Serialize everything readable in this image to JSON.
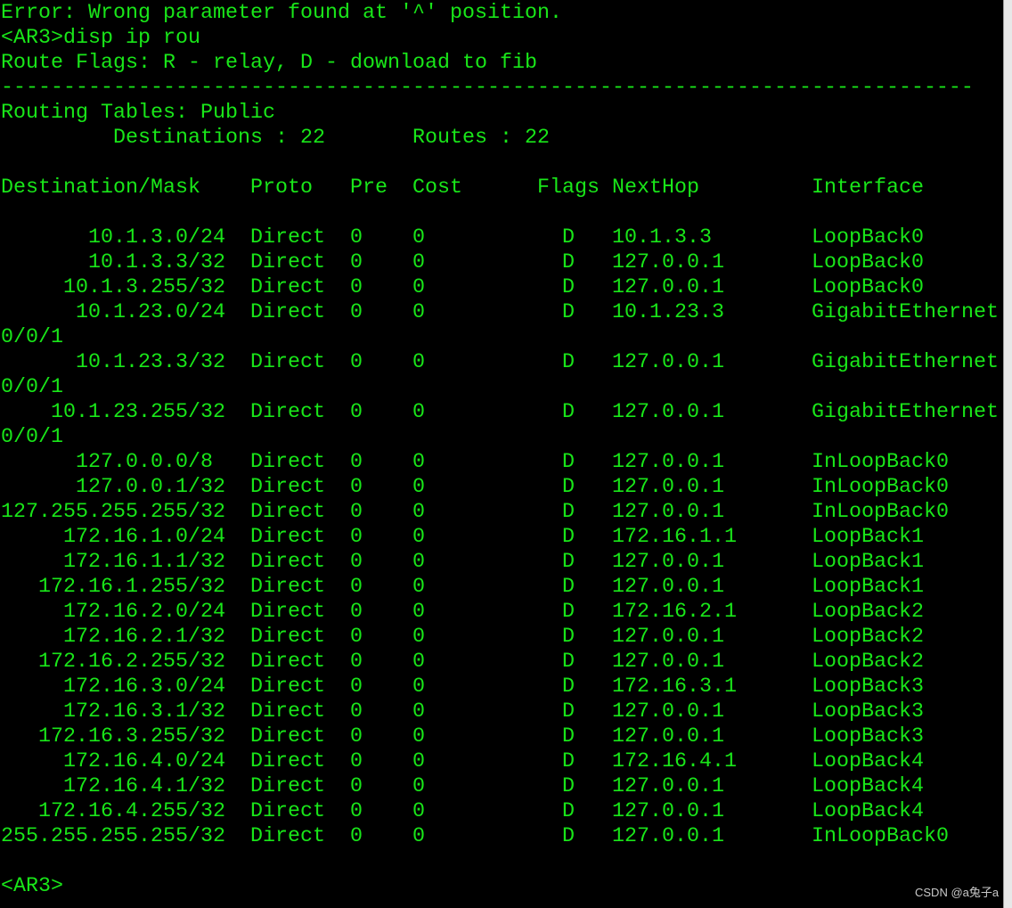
{
  "colors": {
    "background": "#000000",
    "text": "#19e619",
    "watermark": "#c8c8c8"
  },
  "error_message": "Error: Wrong parameter found at '^' position.",
  "prompt": "<AR3>",
  "command": "disp ip rou",
  "route_flags": "Route Flags: R - relay, D - download to fib",
  "separator": "------------------------------------------------------------------------------",
  "routing_tables": "Routing Tables: Public",
  "summary": {
    "destinations": "Destinations : 22",
    "routes": "Routes : 22"
  },
  "columns": [
    "Destination/Mask",
    "Proto",
    "Pre",
    "Cost",
    "Flags",
    "NextHop",
    "Interface"
  ],
  "routes": [
    {
      "destination": "10.1.3.0/24",
      "proto": "Direct",
      "pre": "0",
      "cost": "0",
      "flags": "D",
      "nexthop": "10.1.3.3",
      "interface": "LoopBack0"
    },
    {
      "destination": "10.1.3.3/32",
      "proto": "Direct",
      "pre": "0",
      "cost": "0",
      "flags": "D",
      "nexthop": "127.0.0.1",
      "interface": "LoopBack0"
    },
    {
      "destination": "10.1.3.255/32",
      "proto": "Direct",
      "pre": "0",
      "cost": "0",
      "flags": "D",
      "nexthop": "127.0.0.1",
      "interface": "LoopBack0"
    },
    {
      "destination": "10.1.23.0/24",
      "proto": "Direct",
      "pre": "0",
      "cost": "0",
      "flags": "D",
      "nexthop": "10.1.23.3",
      "interface": "GigabitEthernet0/0/1"
    },
    {
      "destination": "10.1.23.3/32",
      "proto": "Direct",
      "pre": "0",
      "cost": "0",
      "flags": "D",
      "nexthop": "127.0.0.1",
      "interface": "GigabitEthernet0/0/1"
    },
    {
      "destination": "10.1.23.255/32",
      "proto": "Direct",
      "pre": "0",
      "cost": "0",
      "flags": "D",
      "nexthop": "127.0.0.1",
      "interface": "GigabitEthernet0/0/1"
    },
    {
      "destination": "127.0.0.0/8",
      "proto": "Direct",
      "pre": "0",
      "cost": "0",
      "flags": "D",
      "nexthop": "127.0.0.1",
      "interface": "InLoopBack0"
    },
    {
      "destination": "127.0.0.1/32",
      "proto": "Direct",
      "pre": "0",
      "cost": "0",
      "flags": "D",
      "nexthop": "127.0.0.1",
      "interface": "InLoopBack0"
    },
    {
      "destination": "127.255.255.255/32",
      "proto": "Direct",
      "pre": "0",
      "cost": "0",
      "flags": "D",
      "nexthop": "127.0.0.1",
      "interface": "InLoopBack0"
    },
    {
      "destination": "172.16.1.0/24",
      "proto": "Direct",
      "pre": "0",
      "cost": "0",
      "flags": "D",
      "nexthop": "172.16.1.1",
      "interface": "LoopBack1"
    },
    {
      "destination": "172.16.1.1/32",
      "proto": "Direct",
      "pre": "0",
      "cost": "0",
      "flags": "D",
      "nexthop": "127.0.0.1",
      "interface": "LoopBack1"
    },
    {
      "destination": "172.16.1.255/32",
      "proto": "Direct",
      "pre": "0",
      "cost": "0",
      "flags": "D",
      "nexthop": "127.0.0.1",
      "interface": "LoopBack1"
    },
    {
      "destination": "172.16.2.0/24",
      "proto": "Direct",
      "pre": "0",
      "cost": "0",
      "flags": "D",
      "nexthop": "172.16.2.1",
      "interface": "LoopBack2"
    },
    {
      "destination": "172.16.2.1/32",
      "proto": "Direct",
      "pre": "0",
      "cost": "0",
      "flags": "D",
      "nexthop": "127.0.0.1",
      "interface": "LoopBack2"
    },
    {
      "destination": "172.16.2.255/32",
      "proto": "Direct",
      "pre": "0",
      "cost": "0",
      "flags": "D",
      "nexthop": "127.0.0.1",
      "interface": "LoopBack2"
    },
    {
      "destination": "172.16.3.0/24",
      "proto": "Direct",
      "pre": "0",
      "cost": "0",
      "flags": "D",
      "nexthop": "172.16.3.1",
      "interface": "LoopBack3"
    },
    {
      "destination": "172.16.3.1/32",
      "proto": "Direct",
      "pre": "0",
      "cost": "0",
      "flags": "D",
      "nexthop": "127.0.0.1",
      "interface": "LoopBack3"
    },
    {
      "destination": "172.16.3.255/32",
      "proto": "Direct",
      "pre": "0",
      "cost": "0",
      "flags": "D",
      "nexthop": "127.0.0.1",
      "interface": "LoopBack3"
    },
    {
      "destination": "172.16.4.0/24",
      "proto": "Direct",
      "pre": "0",
      "cost": "0",
      "flags": "D",
      "nexthop": "172.16.4.1",
      "interface": "LoopBack4"
    },
    {
      "destination": "172.16.4.1/32",
      "proto": "Direct",
      "pre": "0",
      "cost": "0",
      "flags": "D",
      "nexthop": "127.0.0.1",
      "interface": "LoopBack4"
    },
    {
      "destination": "172.16.4.255/32",
      "proto": "Direct",
      "pre": "0",
      "cost": "0",
      "flags": "D",
      "nexthop": "127.0.0.1",
      "interface": "LoopBack4"
    },
    {
      "destination": "255.255.255.255/32",
      "proto": "Direct",
      "pre": "0",
      "cost": "0",
      "flags": "D",
      "nexthop": "127.0.0.1",
      "interface": "InLoopBack0"
    }
  ],
  "watermark": "CSDN @a兔子a"
}
